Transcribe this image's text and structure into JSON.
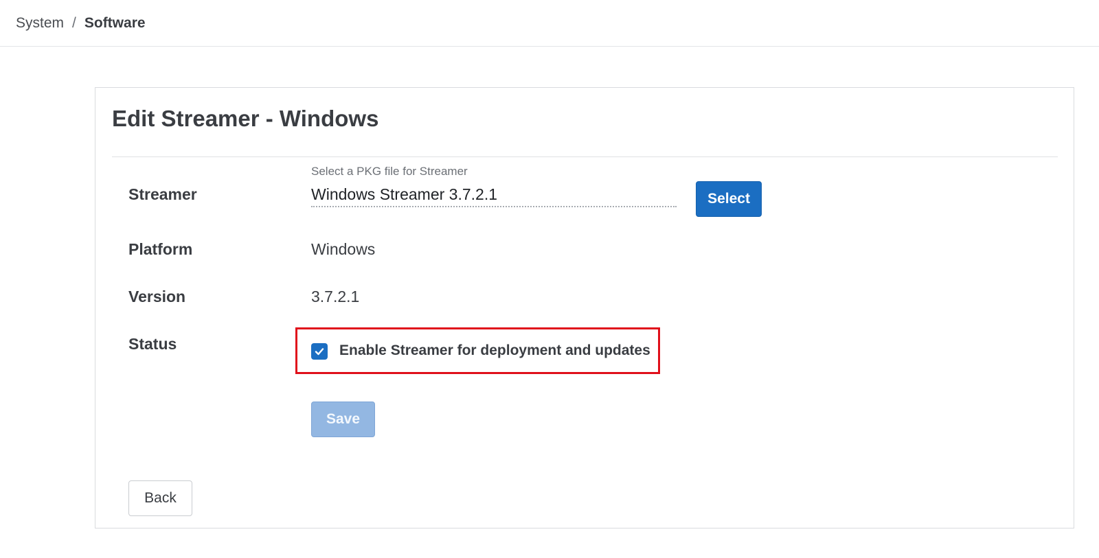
{
  "breadcrumb": {
    "items": [
      "System"
    ],
    "separator": "/",
    "current": "Software"
  },
  "card": {
    "title": "Edit Streamer - Windows",
    "streamer": {
      "label": "Streamer",
      "hint": "Select a PKG file for Streamer",
      "value": "Windows Streamer 3.7.2.1",
      "select_label": "Select"
    },
    "platform": {
      "label": "Platform",
      "value": "Windows"
    },
    "version": {
      "label": "Version",
      "value": "3.7.2.1"
    },
    "status": {
      "label": "Status",
      "checkbox_label": "Enable Streamer for deployment and updates",
      "checked": true,
      "highlight_color": "#e0101b"
    },
    "save_label": "Save",
    "back_label": "Back"
  },
  "colors": {
    "primary": "#1b6ec2",
    "primary_disabled": "#93b7e2",
    "text": "#3a3d42"
  },
  "icons": {
    "checkbox": "check-icon"
  }
}
